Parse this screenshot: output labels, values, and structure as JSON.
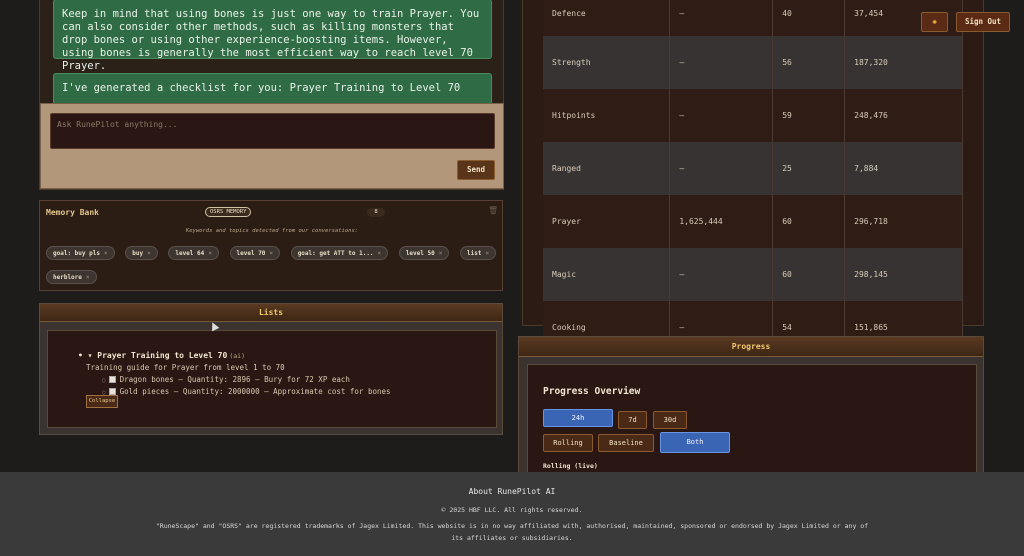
{
  "chat": {
    "message1": "Keep in mind that using bones is just one way to train Prayer. You can also consider other methods, such as killing monsters that drop bones or using other experience-boosting items. However, using bones is generally the most efficient way to reach level 70 Prayer.",
    "message2": "I've generated a checklist for you: Prayer Training to Level 70",
    "input_placeholder": "Ask RunePilot anything...",
    "send_label": "Send"
  },
  "memory": {
    "title": "Memory Bank",
    "badge": "OSRS MEMORY",
    "count": "8",
    "subtitle": "Keywords and topics detected from our conversations:",
    "chips": [
      "goal: buy pls",
      "buy",
      "level 64",
      "level 70",
      "goal: get ATT to 1...",
      "level 50",
      "list",
      "herblore"
    ]
  },
  "lists": {
    "title": "Lists",
    "item_title": "▾ Prayer Training to Level 70",
    "item_tag": "(ai)",
    "description": "Training guide for Prayer from level 1 to 70",
    "entries": [
      "Dragon bones — Quantity: 2896 — Bury for 72 XP each",
      "Gold pieces — Quantity: 2000000 — Approximate cost for bones"
    ],
    "collapse_label": "Collapse"
  },
  "skills": {
    "rows": [
      {
        "name": "Defence",
        "rank": "—",
        "level": "40",
        "xp": "37,454"
      },
      {
        "name": "Strength",
        "rank": "—",
        "level": "56",
        "xp": "187,320"
      },
      {
        "name": "Hitpoints",
        "rank": "—",
        "level": "59",
        "xp": "248,476"
      },
      {
        "name": "Ranged",
        "rank": "—",
        "level": "25",
        "xp": "7,884"
      },
      {
        "name": "Prayer",
        "rank": "1,625,444",
        "level": "60",
        "xp": "296,718"
      },
      {
        "name": "Magic",
        "rank": "—",
        "level": "60",
        "xp": "298,145"
      },
      {
        "name": "Cooking",
        "rank": "—",
        "level": "54",
        "xp": "151,865"
      }
    ]
  },
  "header": {
    "theme_icon": "sun-icon",
    "theme_glyph": "✺",
    "signout_label": "Sign Out"
  },
  "progress": {
    "title": "Progress",
    "overview_title": "Progress Overview",
    "ranges": [
      "24h",
      "7d",
      "30d"
    ],
    "modes": [
      "Rolling",
      "Baseline",
      "Both"
    ],
    "active_range": "24h",
    "active_mode": "Both",
    "live_label": "Rolling (live)"
  },
  "footer": {
    "about": "About RunePilot AI",
    "copyright": "© 2025 HBF LLC. All rights reserved.",
    "trademark": "\"RuneScape\" and \"OSRS\" are registered trademarks of Jagex Limited. This website is in no way affiliated with, authorised, maintained, sponsored or endorsed by Jagex Limited or any of its affiliates or subsidiaries."
  }
}
